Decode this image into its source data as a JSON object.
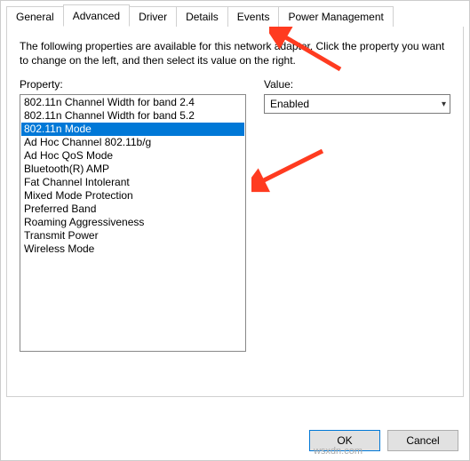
{
  "tabs": {
    "general": "General",
    "advanced": "Advanced",
    "driver": "Driver",
    "details": "Details",
    "events": "Events",
    "power": "Power Management"
  },
  "instructions": "The following properties are available for this network adapter. Click the property you want to change on the left, and then select its value on the right.",
  "property_label": "Property:",
  "value_label": "Value:",
  "properties": [
    "802.11n Channel Width for band 2.4",
    "802.11n Channel Width for band 5.2",
    "802.11n Mode",
    "Ad Hoc Channel 802.11b/g",
    "Ad Hoc QoS Mode",
    "Bluetooth(R) AMP",
    "Fat Channel Intolerant",
    "Mixed Mode Protection",
    "Preferred Band",
    "Roaming Aggressiveness",
    "Transmit Power",
    "Wireless Mode"
  ],
  "selected_index": 2,
  "value_selected": "Enabled",
  "buttons": {
    "ok": "OK",
    "cancel": "Cancel"
  },
  "watermark": "wsxdn.com"
}
